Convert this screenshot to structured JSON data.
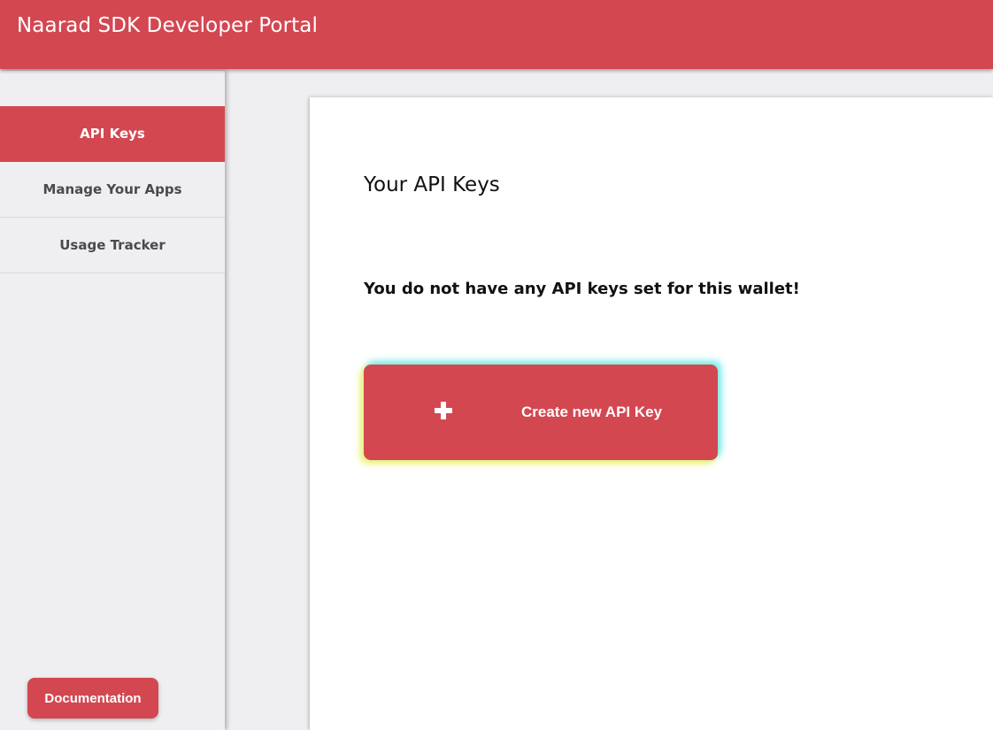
{
  "header": {
    "title": "Naarad SDK Developer Portal"
  },
  "sidebar": {
    "items": [
      {
        "label": "API Keys",
        "active": true
      },
      {
        "label": "Manage Your Apps",
        "active": false
      },
      {
        "label": "Usage Tracker",
        "active": false
      }
    ],
    "documentation_label": "Documentation"
  },
  "main": {
    "title": "Your API Keys",
    "empty_message": "You do not have any API keys set for this wallet!",
    "create_button": {
      "icon": "plus-icon",
      "label": "Create new API Key"
    }
  },
  "colors": {
    "accent": "#d34751",
    "background": "#efeff1",
    "card": "#ffffff"
  }
}
